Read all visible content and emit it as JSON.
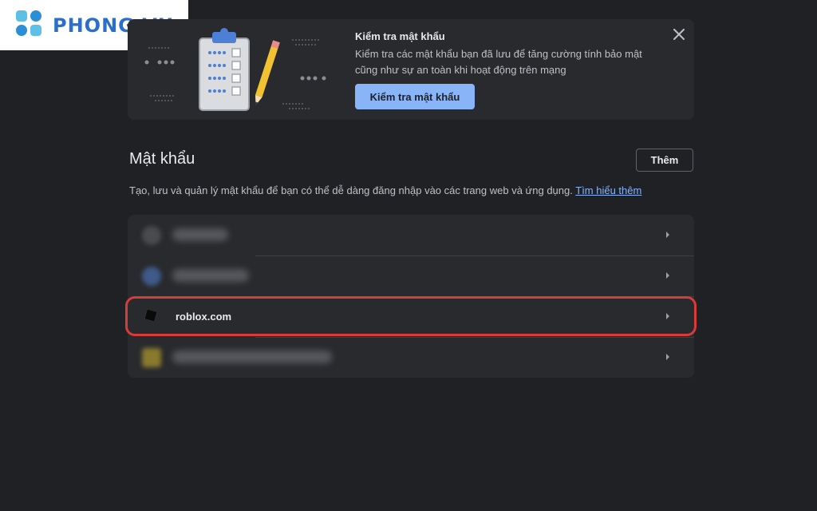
{
  "watermark": {
    "brand": "PHONG VU"
  },
  "banner": {
    "title": "Kiểm tra mật khẩu",
    "description": "Kiểm tra các mật khẩu bạn đã lưu để tăng cường tính bảo mật cũng như sự an toàn khi hoạt động trên mạng",
    "button_label": "Kiểm tra mật khẩu",
    "close_icon": "close-icon"
  },
  "section": {
    "title": "Mật khẩu",
    "add_label": "Thêm",
    "description": "Tạo, lưu và quản lý mật khẩu để bạn có thể dễ dàng đăng nhập vào các trang web và ứng dụng.",
    "learn_more": "Tìm hiểu thêm"
  },
  "passwords": [
    {
      "site": "",
      "blurred": true,
      "favicon_color": "#4a4b4f"
    },
    {
      "site": "",
      "blurred": true,
      "favicon_color": "#3f5a8a"
    },
    {
      "site": "roblox.com",
      "blurred": false,
      "favicon_color": "#111111"
    },
    {
      "site": "",
      "blurred": true,
      "favicon_color": "#8a7a2e"
    }
  ],
  "colors": {
    "accent": "#8ab4f8",
    "highlight": "#d93a3a",
    "background": "#202124",
    "card": "#292a2d"
  }
}
